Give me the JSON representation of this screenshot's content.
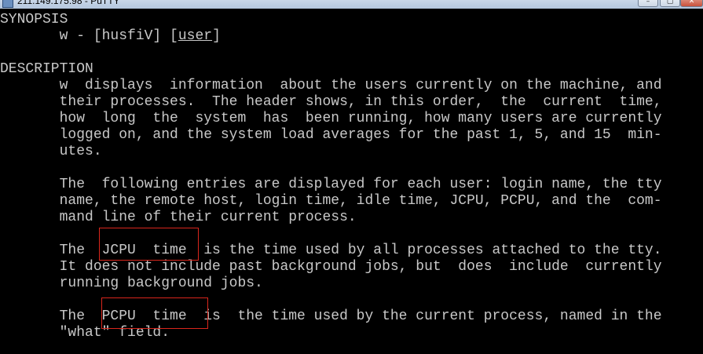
{
  "window": {
    "title": "211.149.175.98 - PuTTY",
    "icon": "putty-icon",
    "buttons": {
      "minimize": "–",
      "maximize": "▢",
      "close": "✕"
    }
  },
  "terminal": {
    "lines": [
      {
        "segments": [
          {
            "text": "SYNOPSIS"
          }
        ]
      },
      {
        "segments": [
          {
            "text": "       w - [husfiV] "
          },
          {
            "text": "["
          },
          {
            "text": "user",
            "underline": true
          },
          {
            "text": "]"
          }
        ]
      },
      {
        "segments": [
          {
            "text": ""
          }
        ]
      },
      {
        "segments": [
          {
            "text": "DESCRIPTION"
          }
        ]
      },
      {
        "segments": [
          {
            "text": "       w  displays  information  about the users currently on the machine, and"
          }
        ]
      },
      {
        "segments": [
          {
            "text": "       their processes.  The header shows, in this order,  the  current  time,"
          }
        ]
      },
      {
        "segments": [
          {
            "text": "       how  long  the  system  has  been running, how many users are currently"
          }
        ]
      },
      {
        "segments": [
          {
            "text": "       logged on, and the system load averages for the past 1, 5, and 15  min-"
          }
        ]
      },
      {
        "segments": [
          {
            "text": "       utes."
          }
        ]
      },
      {
        "segments": [
          {
            "text": ""
          }
        ]
      },
      {
        "segments": [
          {
            "text": "       The  following entries are displayed for each user: login name, the tty"
          }
        ]
      },
      {
        "segments": [
          {
            "text": "       name, the remote host, login time, idle time, JCPU, PCPU, and the  com-"
          }
        ]
      },
      {
        "segments": [
          {
            "text": "       mand line of their current process."
          }
        ]
      },
      {
        "segments": [
          {
            "text": ""
          }
        ]
      },
      {
        "segments": [
          {
            "text": "       The  JCPU  time  is the time used by all processes attached to the tty."
          }
        ]
      },
      {
        "segments": [
          {
            "text": "       It does not include past background jobs, but  does  include  currently"
          }
        ]
      },
      {
        "segments": [
          {
            "text": "       running background jobs."
          }
        ]
      },
      {
        "segments": [
          {
            "text": ""
          }
        ]
      },
      {
        "segments": [
          {
            "text": "       The  PCPU  time  is  the time used by the current process, named in the"
          }
        ]
      },
      {
        "segments": [
          {
            "text": "       \"what\" field."
          }
        ]
      }
    ]
  },
  "highlights": [
    {
      "name": "jcpu-time-highlight",
      "text": "JCPU  time",
      "color": "#d9261c"
    },
    {
      "name": "pcpu-time-highlight",
      "text": "PCPU  time",
      "color": "#d9261c"
    }
  ],
  "colors": {
    "background": "#000000",
    "foreground": "#c8c8c8",
    "highlight_border": "#d9261c"
  }
}
